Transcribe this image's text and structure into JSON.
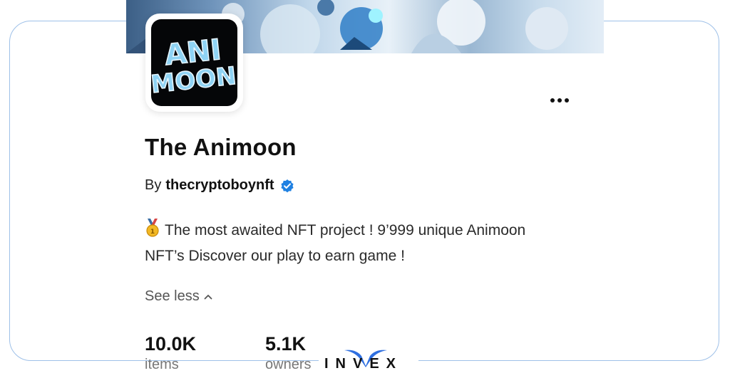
{
  "collection": {
    "title": "The Animoon",
    "by_prefix": "By",
    "creator": "thecryptoboynft",
    "description": "The most awaited NFT project ! 9’999 unique Animoon NFT’s Discover our play to earn game !",
    "see_less_label": "See less"
  },
  "avatar": {
    "logo_line1": "ANI",
    "logo_line2": "MOON"
  },
  "stats": [
    {
      "value": "10.0K",
      "label": "items"
    },
    {
      "value": "5.1K",
      "label": "owners"
    }
  ],
  "watermark": {
    "text": "INVEX"
  },
  "icons": {
    "more": "more-horizontal-icon",
    "verified": "verified-badge-icon",
    "chevron": "chevron-up-icon",
    "medal": "medal-icon"
  },
  "colors": {
    "verified_blue": "#2081e2",
    "frame_border": "#9ec0e8",
    "logo_blue": "#8fd3f4"
  }
}
